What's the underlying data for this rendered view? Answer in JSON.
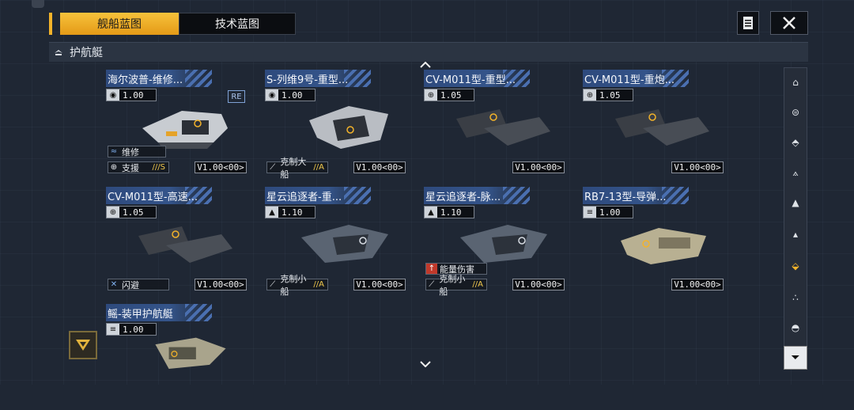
{
  "tabs": [
    {
      "label": "舰船蓝图",
      "active": true
    },
    {
      "label": "技术蓝图",
      "active": false
    }
  ],
  "category": {
    "label": "护航艇"
  },
  "cards": [
    {
      "title": "海尔波普-维修...",
      "cost": "1.00",
      "cost_icon": "cost-icon",
      "badge": "RE",
      "tags": [
        {
          "icon": "repair-icon",
          "label": "维修"
        },
        {
          "icon": "support-icon",
          "label": "支援",
          "rank": "///S"
        }
      ],
      "version": "V1.00<00>"
    },
    {
      "title": "S-列维9号-重型...",
      "cost": "1.00",
      "cost_icon": "cost-icon",
      "tags": [
        {
          "icon": "counter-icon",
          "label": "克制大船",
          "rank": "//A"
        }
      ],
      "version": "V1.00<00>"
    },
    {
      "title": "CV-M011型-重型...",
      "cost": "1.05",
      "cost_icon": "cost-icon",
      "tags": [],
      "version": "V1.00<00>"
    },
    {
      "title": "CV-M011型-重炮...",
      "cost": "1.05",
      "cost_icon": "cost-icon",
      "tags": [],
      "version": "V1.00<00>"
    },
    {
      "title": "CV-M011型-高速...",
      "cost": "1.05",
      "cost_icon": "cost-icon",
      "tags": [
        {
          "icon": "evade-icon",
          "label": "闪避"
        }
      ],
      "version": "V1.00<00>"
    },
    {
      "title": "星云追逐者-重...",
      "cost": "1.10",
      "cost_icon": "cost-icon",
      "tags": [
        {
          "icon": "counter-icon",
          "label": "克制小船",
          "rank": "//A"
        }
      ],
      "version": "V1.00<00>"
    },
    {
      "title": "星云追逐者-脉...",
      "cost": "1.10",
      "cost_icon": "cost-icon",
      "tags": [
        {
          "icon": "energy-damage-icon",
          "label": "能量伤害"
        },
        {
          "icon": "counter-icon",
          "label": "克制小船",
          "rank": "//A"
        }
      ],
      "version": "V1.00<00>"
    },
    {
      "title": "RB7-13型-导弹...",
      "cost": "1.00",
      "cost_icon": "cost-icon",
      "tags": [],
      "version": "V1.00<00>"
    },
    {
      "title": "鳐-装甲护航艇",
      "cost": "1.00",
      "cost_icon": "cost-icon",
      "tags": [],
      "version": ""
    }
  ],
  "side_filters": [
    {
      "icon": "carrier-icon"
    },
    {
      "icon": "battlecruiser-icon"
    },
    {
      "icon": "cruiser-icon"
    },
    {
      "icon": "destroyer-icon"
    },
    {
      "icon": "frigate-icon"
    },
    {
      "icon": "corvette-icon"
    },
    {
      "icon": "escort-icon",
      "active": true
    },
    {
      "icon": "fighter-icon"
    },
    {
      "icon": "aux-icon"
    }
  ],
  "colors": {
    "accent": "#f3b32a",
    "title_bar": "#34548a",
    "background": "#1f2734"
  }
}
